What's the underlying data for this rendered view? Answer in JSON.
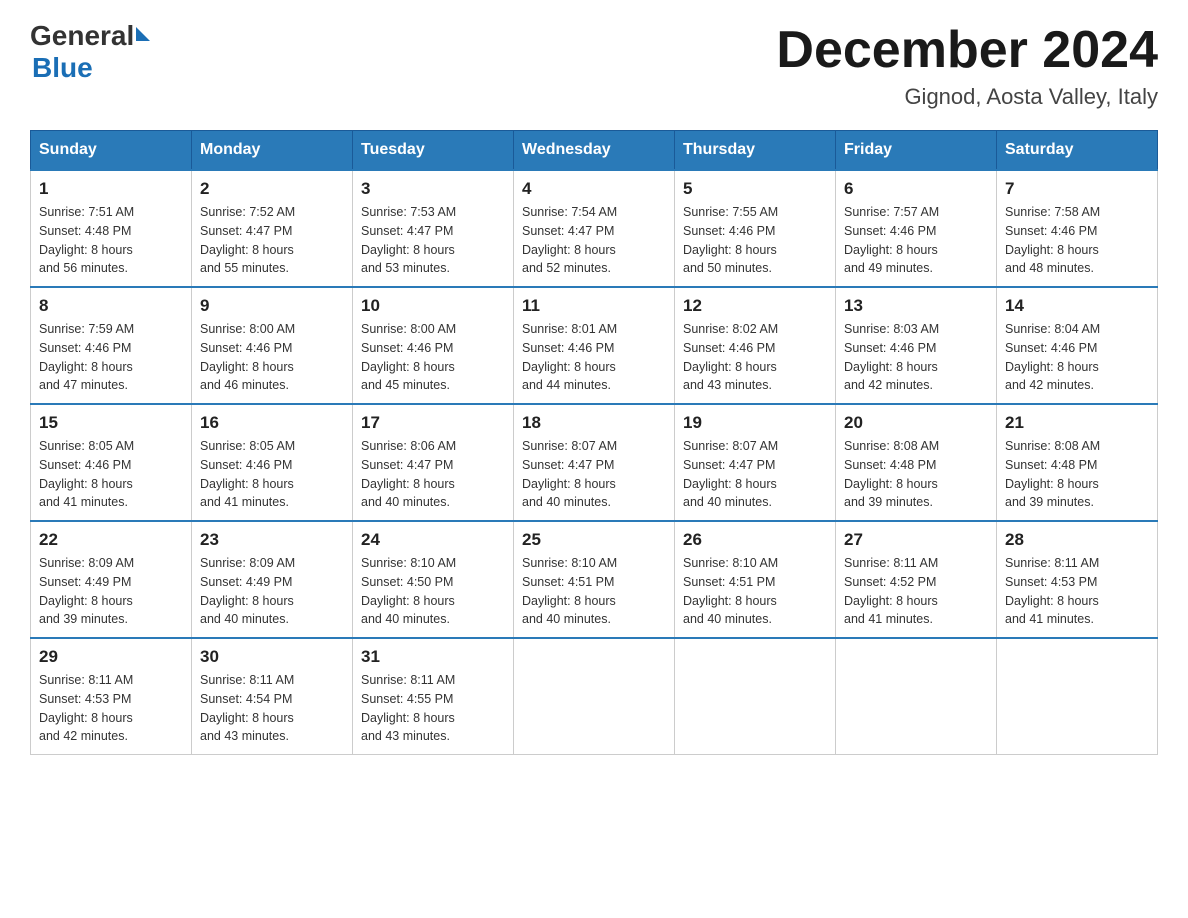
{
  "header": {
    "logo_general": "General",
    "logo_blue": "Blue",
    "title": "December 2024",
    "subtitle": "Gignod, Aosta Valley, Italy"
  },
  "days_of_week": [
    "Sunday",
    "Monday",
    "Tuesday",
    "Wednesday",
    "Thursday",
    "Friday",
    "Saturday"
  ],
  "weeks": [
    [
      {
        "day": "1",
        "sunrise": "Sunrise: 7:51 AM",
        "sunset": "Sunset: 4:48 PM",
        "daylight": "Daylight: 8 hours",
        "daylight2": "and 56 minutes."
      },
      {
        "day": "2",
        "sunrise": "Sunrise: 7:52 AM",
        "sunset": "Sunset: 4:47 PM",
        "daylight": "Daylight: 8 hours",
        "daylight2": "and 55 minutes."
      },
      {
        "day": "3",
        "sunrise": "Sunrise: 7:53 AM",
        "sunset": "Sunset: 4:47 PM",
        "daylight": "Daylight: 8 hours",
        "daylight2": "and 53 minutes."
      },
      {
        "day": "4",
        "sunrise": "Sunrise: 7:54 AM",
        "sunset": "Sunset: 4:47 PM",
        "daylight": "Daylight: 8 hours",
        "daylight2": "and 52 minutes."
      },
      {
        "day": "5",
        "sunrise": "Sunrise: 7:55 AM",
        "sunset": "Sunset: 4:46 PM",
        "daylight": "Daylight: 8 hours",
        "daylight2": "and 50 minutes."
      },
      {
        "day": "6",
        "sunrise": "Sunrise: 7:57 AM",
        "sunset": "Sunset: 4:46 PM",
        "daylight": "Daylight: 8 hours",
        "daylight2": "and 49 minutes."
      },
      {
        "day": "7",
        "sunrise": "Sunrise: 7:58 AM",
        "sunset": "Sunset: 4:46 PM",
        "daylight": "Daylight: 8 hours",
        "daylight2": "and 48 minutes."
      }
    ],
    [
      {
        "day": "8",
        "sunrise": "Sunrise: 7:59 AM",
        "sunset": "Sunset: 4:46 PM",
        "daylight": "Daylight: 8 hours",
        "daylight2": "and 47 minutes."
      },
      {
        "day": "9",
        "sunrise": "Sunrise: 8:00 AM",
        "sunset": "Sunset: 4:46 PM",
        "daylight": "Daylight: 8 hours",
        "daylight2": "and 46 minutes."
      },
      {
        "day": "10",
        "sunrise": "Sunrise: 8:00 AM",
        "sunset": "Sunset: 4:46 PM",
        "daylight": "Daylight: 8 hours",
        "daylight2": "and 45 minutes."
      },
      {
        "day": "11",
        "sunrise": "Sunrise: 8:01 AM",
        "sunset": "Sunset: 4:46 PM",
        "daylight": "Daylight: 8 hours",
        "daylight2": "and 44 minutes."
      },
      {
        "day": "12",
        "sunrise": "Sunrise: 8:02 AM",
        "sunset": "Sunset: 4:46 PM",
        "daylight": "Daylight: 8 hours",
        "daylight2": "and 43 minutes."
      },
      {
        "day": "13",
        "sunrise": "Sunrise: 8:03 AM",
        "sunset": "Sunset: 4:46 PM",
        "daylight": "Daylight: 8 hours",
        "daylight2": "and 42 minutes."
      },
      {
        "day": "14",
        "sunrise": "Sunrise: 8:04 AM",
        "sunset": "Sunset: 4:46 PM",
        "daylight": "Daylight: 8 hours",
        "daylight2": "and 42 minutes."
      }
    ],
    [
      {
        "day": "15",
        "sunrise": "Sunrise: 8:05 AM",
        "sunset": "Sunset: 4:46 PM",
        "daylight": "Daylight: 8 hours",
        "daylight2": "and 41 minutes."
      },
      {
        "day": "16",
        "sunrise": "Sunrise: 8:05 AM",
        "sunset": "Sunset: 4:46 PM",
        "daylight": "Daylight: 8 hours",
        "daylight2": "and 41 minutes."
      },
      {
        "day": "17",
        "sunrise": "Sunrise: 8:06 AM",
        "sunset": "Sunset: 4:47 PM",
        "daylight": "Daylight: 8 hours",
        "daylight2": "and 40 minutes."
      },
      {
        "day": "18",
        "sunrise": "Sunrise: 8:07 AM",
        "sunset": "Sunset: 4:47 PM",
        "daylight": "Daylight: 8 hours",
        "daylight2": "and 40 minutes."
      },
      {
        "day": "19",
        "sunrise": "Sunrise: 8:07 AM",
        "sunset": "Sunset: 4:47 PM",
        "daylight": "Daylight: 8 hours",
        "daylight2": "and 40 minutes."
      },
      {
        "day": "20",
        "sunrise": "Sunrise: 8:08 AM",
        "sunset": "Sunset: 4:48 PM",
        "daylight": "Daylight: 8 hours",
        "daylight2": "and 39 minutes."
      },
      {
        "day": "21",
        "sunrise": "Sunrise: 8:08 AM",
        "sunset": "Sunset: 4:48 PM",
        "daylight": "Daylight: 8 hours",
        "daylight2": "and 39 minutes."
      }
    ],
    [
      {
        "day": "22",
        "sunrise": "Sunrise: 8:09 AM",
        "sunset": "Sunset: 4:49 PM",
        "daylight": "Daylight: 8 hours",
        "daylight2": "and 39 minutes."
      },
      {
        "day": "23",
        "sunrise": "Sunrise: 8:09 AM",
        "sunset": "Sunset: 4:49 PM",
        "daylight": "Daylight: 8 hours",
        "daylight2": "and 40 minutes."
      },
      {
        "day": "24",
        "sunrise": "Sunrise: 8:10 AM",
        "sunset": "Sunset: 4:50 PM",
        "daylight": "Daylight: 8 hours",
        "daylight2": "and 40 minutes."
      },
      {
        "day": "25",
        "sunrise": "Sunrise: 8:10 AM",
        "sunset": "Sunset: 4:51 PM",
        "daylight": "Daylight: 8 hours",
        "daylight2": "and 40 minutes."
      },
      {
        "day": "26",
        "sunrise": "Sunrise: 8:10 AM",
        "sunset": "Sunset: 4:51 PM",
        "daylight": "Daylight: 8 hours",
        "daylight2": "and 40 minutes."
      },
      {
        "day": "27",
        "sunrise": "Sunrise: 8:11 AM",
        "sunset": "Sunset: 4:52 PM",
        "daylight": "Daylight: 8 hours",
        "daylight2": "and 41 minutes."
      },
      {
        "day": "28",
        "sunrise": "Sunrise: 8:11 AM",
        "sunset": "Sunset: 4:53 PM",
        "daylight": "Daylight: 8 hours",
        "daylight2": "and 41 minutes."
      }
    ],
    [
      {
        "day": "29",
        "sunrise": "Sunrise: 8:11 AM",
        "sunset": "Sunset: 4:53 PM",
        "daylight": "Daylight: 8 hours",
        "daylight2": "and 42 minutes."
      },
      {
        "day": "30",
        "sunrise": "Sunrise: 8:11 AM",
        "sunset": "Sunset: 4:54 PM",
        "daylight": "Daylight: 8 hours",
        "daylight2": "and 43 minutes."
      },
      {
        "day": "31",
        "sunrise": "Sunrise: 8:11 AM",
        "sunset": "Sunset: 4:55 PM",
        "daylight": "Daylight: 8 hours",
        "daylight2": "and 43 minutes."
      },
      null,
      null,
      null,
      null
    ]
  ]
}
